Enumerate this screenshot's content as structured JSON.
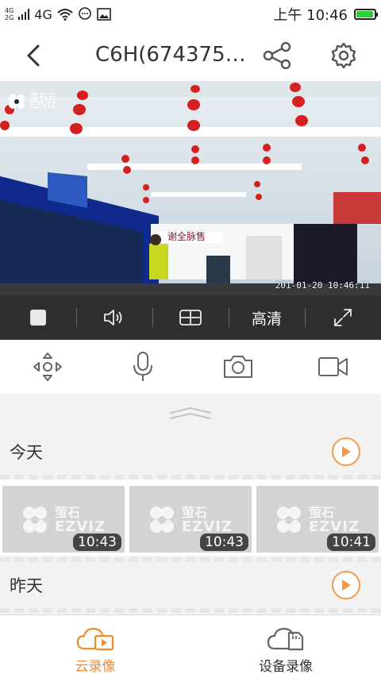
{
  "statusbar": {
    "net_top": "4G",
    "net_bottom": "2G",
    "net_type": "4G",
    "time": "上午 10:46",
    "battery_level": 0.95,
    "battery_color": "#2bd12b"
  },
  "header": {
    "title": "C6H(674375…",
    "back_icon": "chevron-left-icon",
    "share_icon": "share-icon",
    "settings_icon": "gear-icon"
  },
  "video": {
    "watermark_cn": "萤石云",
    "watermark_en": "EZVIZ",
    "timestamp": "201-01-20 10:46:11"
  },
  "controls": {
    "stop_icon": "stop-icon",
    "volume_icon": "volume-icon",
    "layout_icon": "grid-icon",
    "quality_label": "高清",
    "fullscreen_icon": "fullscreen-icon"
  },
  "actions": {
    "ptz_icon": "ptz-direction-icon",
    "mic_icon": "microphone-icon",
    "snapshot_icon": "camera-icon",
    "record_icon": "video-record-icon"
  },
  "sections": [
    {
      "label": "今天"
    },
    {
      "label": "昨天"
    }
  ],
  "thumbnails": [
    {
      "logo_cn": "萤石",
      "logo_en": "EZVIZ",
      "time": "10:43"
    },
    {
      "logo_cn": "萤石",
      "logo_en": "EZVIZ",
      "time": "10:43"
    },
    {
      "logo_cn": "萤石",
      "logo_en": "EZVIZ",
      "time": "10:41"
    }
  ],
  "bottom_nav": {
    "cloud_label": "云录像",
    "device_label": "设备录像",
    "accent": "#f08a2e"
  },
  "colors": {
    "accent": "#f39a4a",
    "control_bar": "#2f2f2f"
  }
}
